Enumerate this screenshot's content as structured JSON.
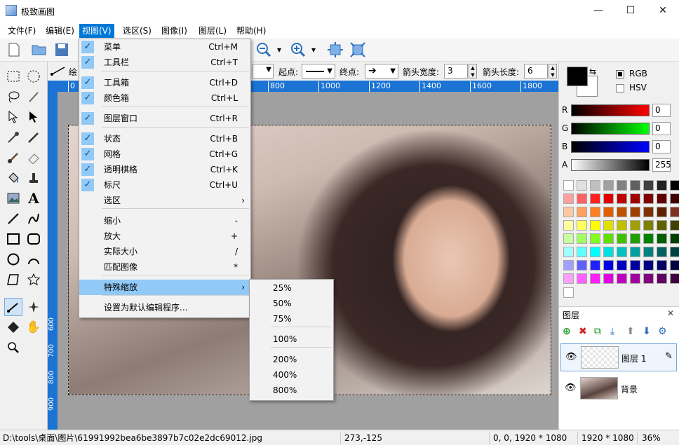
{
  "app": {
    "title": "极致画图"
  },
  "window_controls": {
    "minimize": "—",
    "maximize": "☐",
    "close": "✕"
  },
  "menubar": [
    "文件(F)",
    "编辑(E)",
    "视图(V)",
    "选区(S)",
    "图像(I)",
    "图层(L)",
    "帮助(H)"
  ],
  "options_bar": {
    "tool_label": "绘",
    "start_label": "起点:",
    "end_label": "终点:",
    "arrow_width_label": "箭头宽度:",
    "arrow_width_value": "3",
    "arrow_length_label": "箭头长度:",
    "arrow_length_value": "6"
  },
  "ruler_top": [
    "0",
    "800",
    "1000",
    "1200",
    "1400",
    "1600",
    "1800"
  ],
  "ruler_left": [
    "600",
    "700",
    "800",
    "900"
  ],
  "view_menu": [
    {
      "label": "菜单",
      "shortcut": "Ctrl+M",
      "checked": true
    },
    {
      "label": "工具栏",
      "shortcut": "Ctrl+T",
      "checked": true
    },
    {
      "label": "工具箱",
      "shortcut": "Ctrl+D",
      "checked": true
    },
    {
      "label": "颜色箱",
      "shortcut": "Ctrl+L",
      "checked": true
    },
    {
      "label": "图层窗口",
      "shortcut": "Ctrl+R",
      "checked": true
    },
    {
      "label": "状态",
      "shortcut": "Ctrl+B",
      "checked": true
    },
    {
      "label": "网格",
      "shortcut": "Ctrl+G",
      "checked": true
    },
    {
      "label": "透明棋格",
      "shortcut": "Ctrl+K",
      "checked": true
    },
    {
      "label": "标尺",
      "shortcut": "Ctrl+U",
      "checked": true
    },
    {
      "label": "选区",
      "submenu": true
    },
    {
      "label": "缩小",
      "shortcut": "-"
    },
    {
      "label": "放大",
      "shortcut": "+"
    },
    {
      "label": "实际大小",
      "shortcut": "/"
    },
    {
      "label": "匹配图像",
      "shortcut": "*"
    },
    {
      "label": "特殊缩放",
      "submenu": true,
      "highlighted": true
    },
    {
      "label": "设置为默认编辑程序..."
    }
  ],
  "zoom_menu": [
    "25%",
    "50%",
    "75%",
    "100%",
    "200%",
    "400%",
    "800%"
  ],
  "color_panel": {
    "modes": [
      "RGB",
      "HSV"
    ],
    "channels": [
      {
        "name": "R",
        "value": "0"
      },
      {
        "name": "G",
        "value": "0"
      },
      {
        "name": "B",
        "value": "0"
      },
      {
        "name": "A",
        "value": "255"
      }
    ],
    "palette": [
      [
        "#ffffff",
        "#e0e0e0",
        "#c0c0c0",
        "#a0a0a0",
        "#808080",
        "#606060",
        "#404040",
        "#202020",
        "#000000"
      ],
      [
        "#ffa0a0",
        "#ff6060",
        "#ff2020",
        "#e00000",
        "#c00000",
        "#a00000",
        "#800000",
        "#600000",
        "#400000"
      ],
      [
        "#ffc8a0",
        "#ffa060",
        "#ff8020",
        "#e06000",
        "#c05000",
        "#a04000",
        "#803000",
        "#602000",
        "#803020"
      ],
      [
        "#ffffa0",
        "#ffff60",
        "#ffff00",
        "#e0e000",
        "#c0c000",
        "#a0a000",
        "#808000",
        "#606000",
        "#404000"
      ],
      [
        "#c8ffa0",
        "#a0ff60",
        "#80ff20",
        "#60e000",
        "#40c000",
        "#20a000",
        "#008000",
        "#006000",
        "#004000"
      ],
      [
        "#a0ffff",
        "#60ffff",
        "#00ffff",
        "#00e0e0",
        "#00c0c0",
        "#00a0a0",
        "#008080",
        "#006060",
        "#004040"
      ],
      [
        "#a0a0ff",
        "#6060ff",
        "#2020ff",
        "#0000e0",
        "#0000c0",
        "#0000a0",
        "#000080",
        "#000060",
        "#000040"
      ],
      [
        "#ffa0ff",
        "#ff60ff",
        "#ff20ff",
        "#e000e0",
        "#c000c0",
        "#a000a0",
        "#800080",
        "#600060",
        "#400040"
      ]
    ]
  },
  "layers": {
    "title": "图层",
    "items": [
      {
        "name": "图层 1"
      },
      {
        "name": "背景"
      }
    ]
  },
  "status": {
    "path": "D:\\tools\\桌面\\图片\\61991992bea6be3897b7c02e2dc69012.jpg",
    "cursor": "273,-125",
    "selection": "0, 0, 1920 * 1080",
    "size": "1920 * 1080",
    "zoom": "36%"
  }
}
